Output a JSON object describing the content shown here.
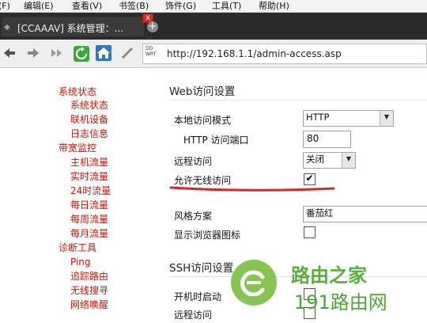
{
  "menu": [
    "(F)",
    "编辑(E)",
    "查看(V)",
    "书签(B)",
    "饰件(G)",
    "工具(T)",
    "帮助(H)"
  ],
  "tab": {
    "title": "[CCAAAV] 系统管理：...",
    "close": "x",
    "new_tab": "+"
  },
  "toolbar": {
    "url": "http://192.168.1.1/admin-access.asp"
  },
  "sidebar": [
    "系统状态",
    "系统状态",
    "联机设备",
    "日志信息",
    "带宽监控",
    "主机流量",
    "实时流量",
    "24时流量",
    "每日流量",
    "每周流量",
    "每月流量",
    "诊断工具",
    "Ping",
    "追踪路由",
    "无线搜寻",
    "网络唤醒"
  ],
  "web": {
    "section": "Web访问设置",
    "mode_label": "本地访问模式",
    "mode_value": "HTTP",
    "port_label": "HTTP 访问端口",
    "port_value": "80",
    "remote_label": "远程访问",
    "remote_value": "关闭",
    "wireless_label": "允许无线访问",
    "wireless_checked": "✔",
    "style_label": "风格方案",
    "style_value": "番茄红",
    "icon_label": "显示浏览器图标"
  },
  "ssh": {
    "section": "SSH访问设置",
    "boot_label": "开机时启动",
    "remote_label": "远程访问"
  },
  "watermark": {
    "line1": "路由之家",
    "line2": "191路由网"
  },
  "colors": {
    "sidebar_accent": "#cc1100",
    "underline": "#d9242a",
    "tabbar": "#2b2b2b"
  }
}
